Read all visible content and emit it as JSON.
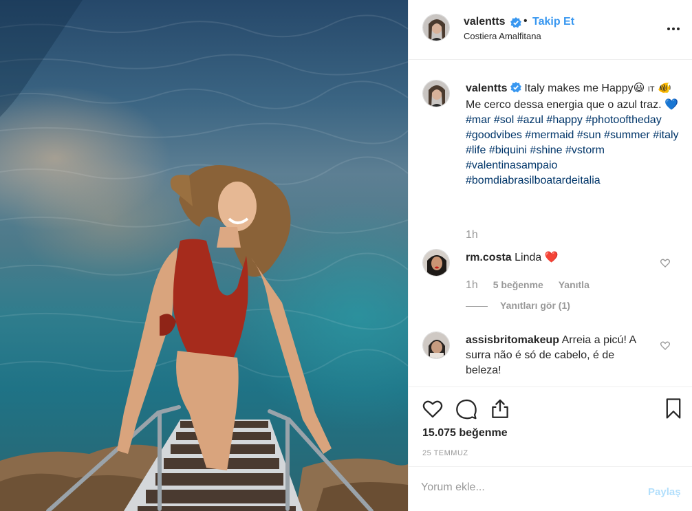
{
  "post": {
    "username": "valentts",
    "separator": "•",
    "follow_label": "Takip Et",
    "location": "Costiera Amalfitana",
    "more_icon": "more-horizontal-icon",
    "verified_color": "#3897f0"
  },
  "caption": {
    "username": "valentts",
    "text_line1": "Italy makes me Happy",
    "emoji_smile": "😃",
    "flag_text": "IT",
    "emoji_fish": "🐠",
    "text_line2": "Me cerco dessa energia que o azul traz.",
    "emoji_heart": "💙",
    "hashtags": [
      "#mar",
      "#sol",
      "#azul",
      "#happy",
      "#photooftheday",
      "#goodvibes",
      "#mermaid",
      "#sun",
      "#summer",
      "#italy",
      "#life",
      "#biquini",
      "#shine",
      "#vstorm",
      "#valentinasampaio",
      "#bomdiabrasilboatardeitalia"
    ],
    "time": "1h"
  },
  "comments": [
    {
      "username": "rm.costa",
      "text": "Linda",
      "emoji": "❤️",
      "time": "1h",
      "likes": "5 beğenme",
      "reply": "Yanıtla",
      "view_replies": "Yanıtları gör (1)"
    },
    {
      "username": "assisbritomakeup",
      "text": "Arreia a picú! A surra não é só de cabelo, é de beleza!"
    }
  ],
  "actions": {
    "like_icon": "heart-icon",
    "comment_icon": "comment-icon",
    "share_icon": "share-icon",
    "save_icon": "bookmark-icon",
    "likes_count": "15.075 beğenme",
    "date": "25 TEMMUZ"
  },
  "add_comment": {
    "placeholder": "Yorum ekle...",
    "share_label": "Paylaş"
  },
  "colors": {
    "accent": "#3897f0",
    "hashtag": "#003569",
    "muted": "#999999",
    "share_disabled": "#b2dffc"
  }
}
